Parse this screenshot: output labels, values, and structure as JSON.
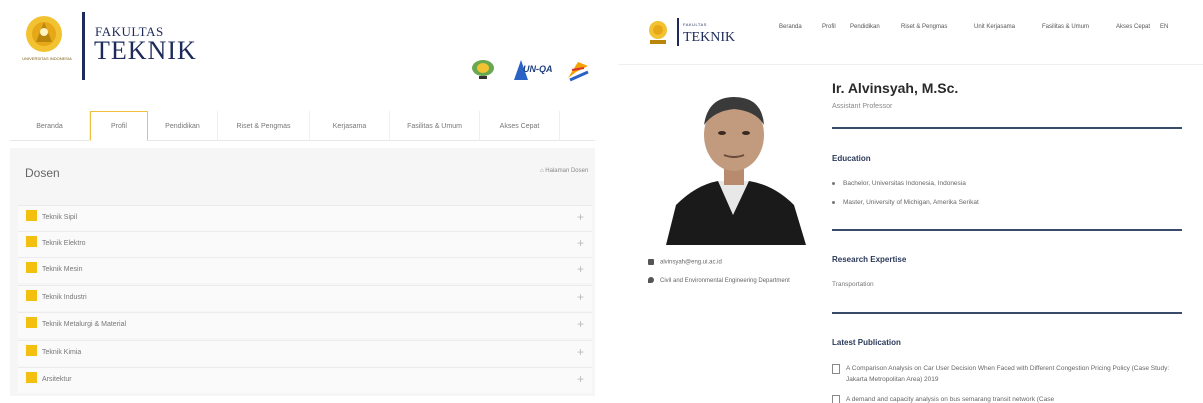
{
  "left": {
    "logo_text": "UNIVERSITAS INDONESIA",
    "faculty_small": "FAKULTAS",
    "faculty_big": "TEKNIK",
    "badges": [
      "award-badge",
      "AUN-QA",
      "accreditation-badge"
    ],
    "badge_aun_text": "UN-QA",
    "nav": {
      "tabs": [
        {
          "label": "Beranda",
          "active": false
        },
        {
          "label": "Profil",
          "active": true
        },
        {
          "label": "Pendidikan",
          "active": false
        },
        {
          "label": "Riset & Pengmas",
          "active": false
        },
        {
          "label": "Kerjasama",
          "active": false
        },
        {
          "label": "Fasilitas & Umum",
          "active": false
        },
        {
          "label": "Akses Cepat",
          "active": false
        }
      ]
    },
    "page_title": "Dosen",
    "breadcrumb": "⌂ Halaman Dosen",
    "departments": [
      "Teknik Sipil",
      "Teknik Elektro",
      "Teknik Mesin",
      "Teknik Industri",
      "Teknik Metalurgi & Material",
      "Teknik Kimia",
      "Arsitektur"
    ],
    "accent_color": "#f4c010"
  },
  "right": {
    "header": {
      "faculty_small": "FAKULTAS",
      "faculty_big": "TEKNIK",
      "menu": [
        "Beranda",
        "Profil",
        "Pendidikan",
        "Riset & Pengmas",
        "Unit Kerjasama",
        "Fasilitas & Umum",
        "Akses Cepat",
        "EN"
      ]
    },
    "profile": {
      "name": "Ir. Alvinsyah, M.Sc.",
      "role": "Assistant Professor",
      "email": "alvinsyah@eng.ui.ac.id",
      "department": "Civil and Environmental Engineering Department"
    },
    "education": {
      "title": "Education",
      "items": [
        "Bachelor, Universitas Indonesia, Indonesia",
        "Master, University of Michigan, Amerika Serikat"
      ]
    },
    "research": {
      "title": "Research Expertise",
      "value": "Transportation"
    },
    "publications": {
      "title": "Latest Publication",
      "items": [
        "A Comparison Analysis on Car User Decision When Faced with Different Congestion Pricing Policy (Case Study: Jakarta Metropolitan Area)  2019",
        "A demand and capacity analysis on bus semarang transit network (Case"
      ]
    },
    "divider_color": "#3a4a6a"
  }
}
